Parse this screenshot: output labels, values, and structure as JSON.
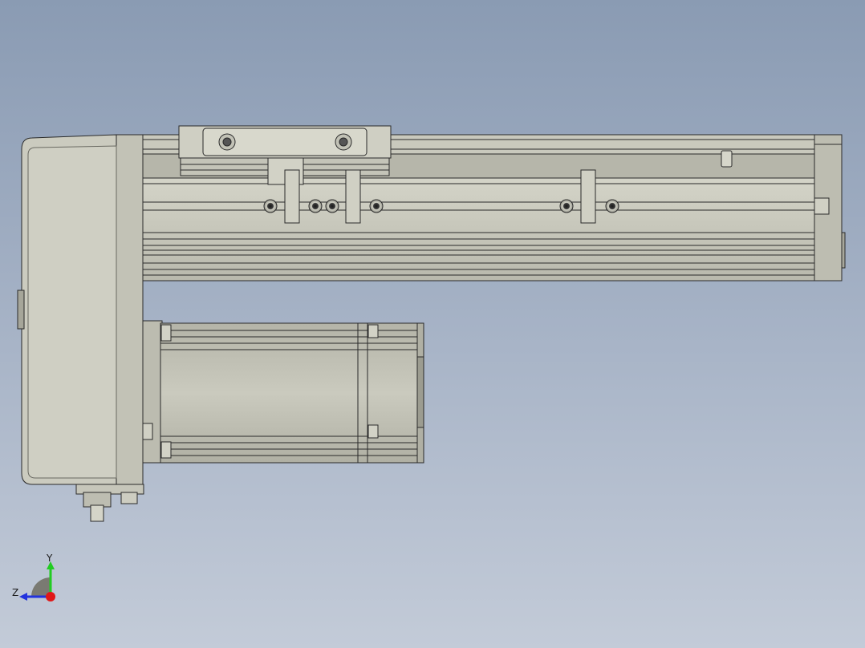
{
  "view": {
    "background_top": "#8a9bb3",
    "background_bottom": "#c3cbd8",
    "part_fill": "#c8c8bd",
    "part_edge": "#2a2a2a"
  },
  "triad": {
    "y_label": "Y",
    "z_label": "Z",
    "y_color": "#22cc22",
    "z_color": "#2233dd",
    "x_color": "#e01818"
  }
}
